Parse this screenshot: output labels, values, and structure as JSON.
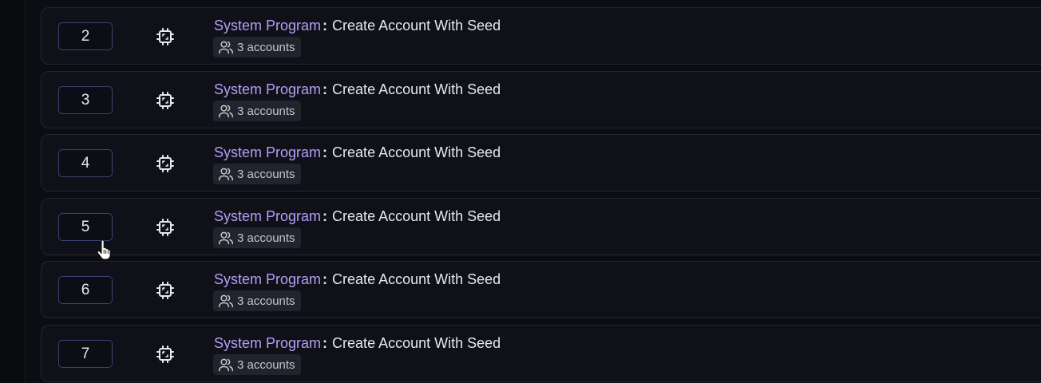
{
  "rows": [
    {
      "index": "2",
      "program": "System Program",
      "separator": ":",
      "instruction": "Create Account With Seed",
      "accounts": "3 accounts"
    },
    {
      "index": "3",
      "program": "System Program",
      "separator": ":",
      "instruction": "Create Account With Seed",
      "accounts": "3 accounts"
    },
    {
      "index": "4",
      "program": "System Program",
      "separator": ":",
      "instruction": "Create Account With Seed",
      "accounts": "3 accounts"
    },
    {
      "index": "5",
      "program": "System Program",
      "separator": ":",
      "instruction": "Create Account With Seed",
      "accounts": "3 accounts"
    },
    {
      "index": "6",
      "program": "System Program",
      "separator": ":",
      "instruction": "Create Account With Seed",
      "accounts": "3 accounts"
    },
    {
      "index": "7",
      "program": "System Program",
      "separator": ":",
      "instruction": "Create Account With Seed",
      "accounts": "3 accounts"
    }
  ],
  "colors": {
    "program": "#b79cf7",
    "index_border": "#3a4370",
    "background": "#0c0d12"
  },
  "icons": {
    "program_icon": "chip-icon",
    "accounts_icon": "users-icon",
    "cursor": "hand-pointer-icon"
  }
}
